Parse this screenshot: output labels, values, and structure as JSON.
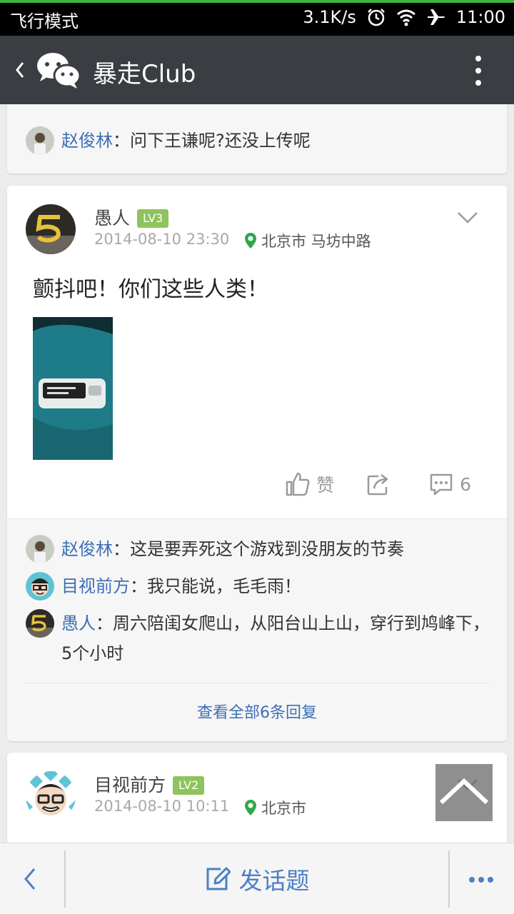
{
  "status_bar": {
    "mode": "飞行模式",
    "speed": "3.1K/s",
    "time": "11:00"
  },
  "header": {
    "title": "暴走Club"
  },
  "card1": {
    "reply": {
      "name": "赵俊林",
      "text": "：问下王谦呢?还没上传呢"
    }
  },
  "post": {
    "author": "愚人",
    "level": "LV3",
    "time": "2014-08-10 23:30",
    "location": "北京市 马坊中路",
    "content": "颤抖吧！你们这些人类！",
    "like_label": "赞",
    "comment_count": "6",
    "replies": [
      {
        "name": "赵俊林",
        "text": "：这是要弄死这个游戏到没朋友的节奏"
      },
      {
        "name": "目视前方",
        "text": "：我只能说，毛毛雨！"
      },
      {
        "name": "愚人",
        "text": "：周六陪闺女爬山，从阳台山上山，穿行到鸠峰下，5个小时"
      }
    ],
    "view_all": "查看全部6条回复"
  },
  "post2": {
    "author": "目视前方",
    "level": "LV2",
    "time": "2014-08-10 10:11",
    "location": "北京市"
  },
  "bottom_bar": {
    "compose_label": "发话题"
  },
  "colors": {
    "accent": "#4d7fc4",
    "name_blue": "#3c6fb5",
    "badge_green": "#8ec35d",
    "title_bar": "#3a3e42"
  }
}
